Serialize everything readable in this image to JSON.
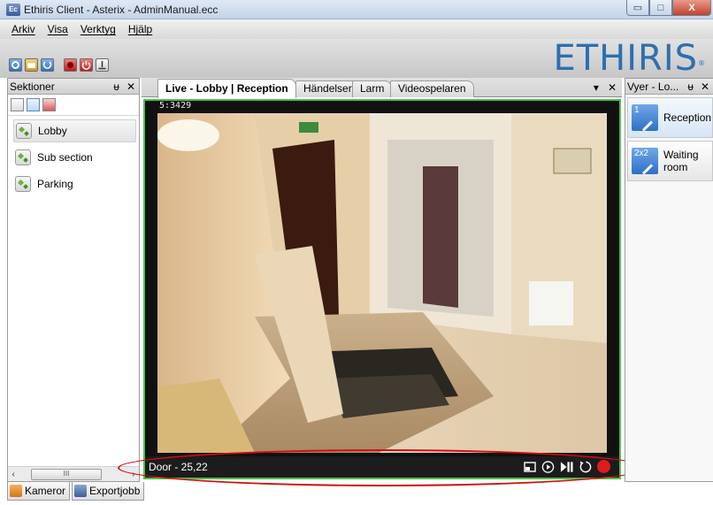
{
  "window": {
    "app_icon": "Ec",
    "title": "Ethiris Client - Asterix - AdminManual.ecc",
    "minimize": "▭",
    "maximize": "□",
    "close": "X"
  },
  "menu": {
    "items": [
      "Arkiv",
      "Visa",
      "Verktyg",
      "Hjälp"
    ]
  },
  "toolbar": {
    "logo": "ETHIRIS",
    "logo_mark": "®",
    "icons": [
      "settings-icon",
      "folder-icon",
      "refresh-icon",
      "record-icon",
      "power-icon",
      "download-icon"
    ]
  },
  "left_panel": {
    "title": "Sektioner",
    "pin": "ᵾ",
    "close": "✕",
    "sections": [
      {
        "label": "Lobby",
        "selected": true
      },
      {
        "label": "Sub section",
        "selected": false
      },
      {
        "label": "Parking",
        "selected": false
      }
    ],
    "scroll_left": "‹",
    "scroll_thumb": "III",
    "scroll_right": "›"
  },
  "bottom_tabs": [
    {
      "label": "Kameror"
    },
    {
      "label": "Exportjobb"
    }
  ],
  "center": {
    "tabs": [
      {
        "label": "Live - Lobby | Reception",
        "active": true
      },
      {
        "label": "Händelser",
        "active": false
      },
      {
        "label": "Larm",
        "active": false
      },
      {
        "label": "Videospelaren",
        "active": false
      }
    ],
    "dropdown": "▾",
    "close": "✕",
    "video": {
      "timestamp": "5:3429",
      "camera_label": "Door - 25,22"
    }
  },
  "right_panel": {
    "title": "Vyer - Lo...",
    "pin": "ᵾ",
    "close": "✕",
    "views": [
      {
        "badge": "1",
        "label": "Reception",
        "active": true
      },
      {
        "badge": "2x2",
        "label": "Waiting room",
        "active": false
      }
    ]
  },
  "colors": {
    "highlight_frame": "#4cc04c",
    "annotation_ring": "#d10f0f",
    "record": "#e01a1a",
    "logo": "#2d6fb0"
  }
}
